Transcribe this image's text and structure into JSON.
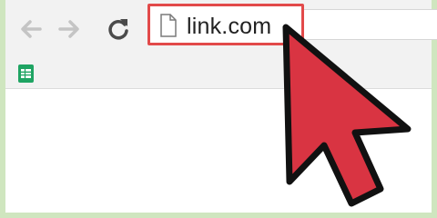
{
  "browser": {
    "address_bar": {
      "url": "link.com",
      "page_icon": "page-icon",
      "highlight_color": "#e24a4a"
    },
    "nav": {
      "back_icon": "back-arrow-icon",
      "forward_icon": "forward-arrow-icon",
      "reload_icon": "reload-icon"
    },
    "bookmarks_bar": {
      "items": [
        {
          "icon": "google-sheets-icon",
          "color": "#1fa463"
        }
      ]
    }
  },
  "overlay": {
    "pointer_icon": "red-cursor-arrow-icon",
    "pointer_color": "#d93442"
  }
}
